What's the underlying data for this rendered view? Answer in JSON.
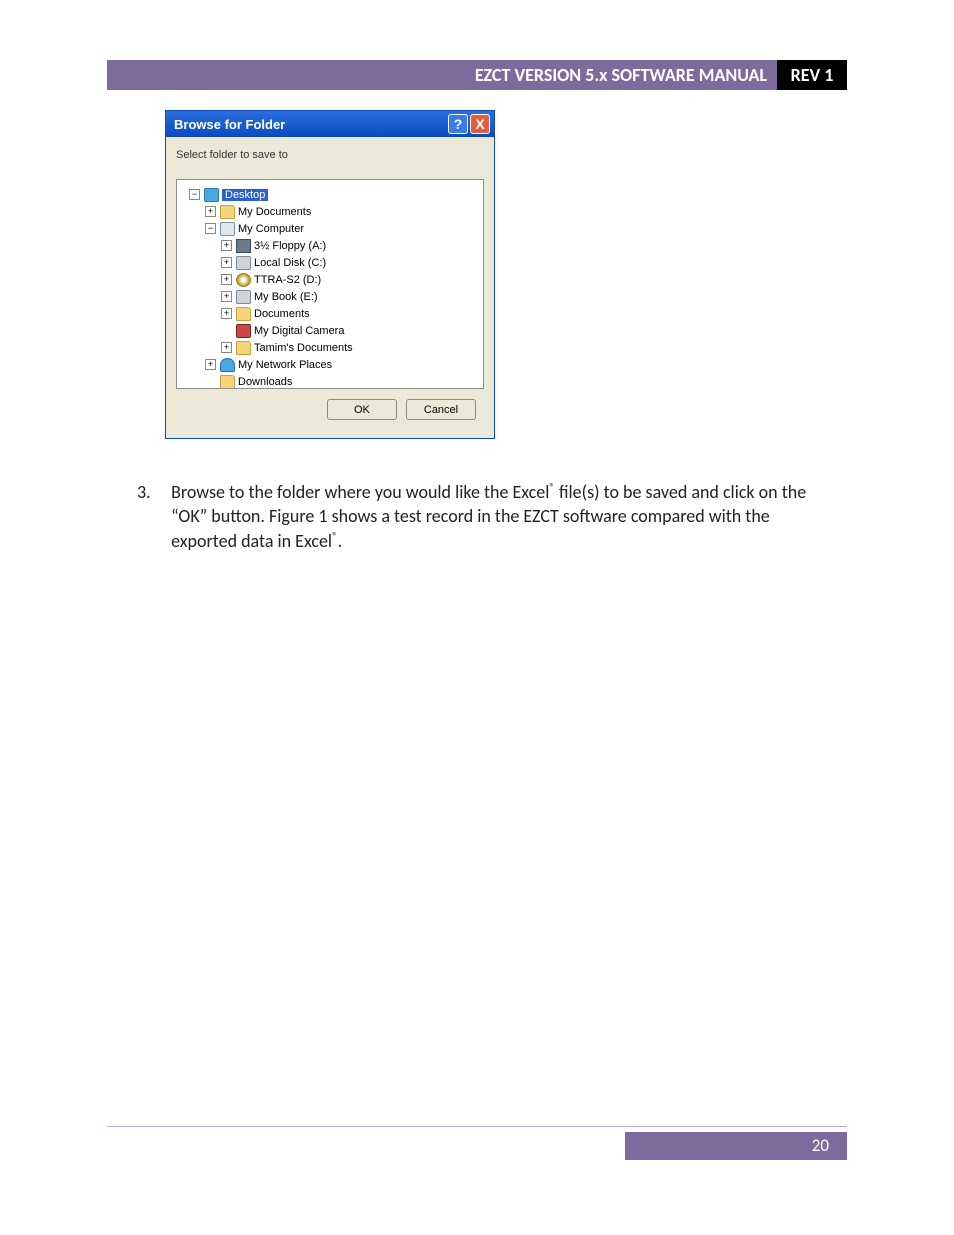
{
  "header": {
    "title": "EZCT VERSION 5.x SOFTWARE MANUAL",
    "rev": "REV 1"
  },
  "dialog": {
    "title": "Browse for Folder",
    "instruction": "Select folder to save to",
    "ok": "OK",
    "cancel": "Cancel",
    "tree": {
      "desktop": "Desktop",
      "mydocs": "My Documents",
      "mycomp": "My Computer",
      "floppy": "3½ Floppy (A:)",
      "localdisk": "Local Disk (C:)",
      "ttra": "TTRA-S2 (D:)",
      "mybook": "My Book (E:)",
      "documents": "Documents",
      "camera": "My Digital Camera",
      "tamim": "Tamim's Documents",
      "netplaces": "My Network Places",
      "downloads": "Downloads"
    }
  },
  "body": {
    "num": "3.",
    "text1": "Browse to the folder where you would like the Excel",
    "text2": " file(s) to be saved and click on the “OK” button. Figure 1 shows a test record in the EZCT software compared with the exported data in Excel",
    "text3": "."
  },
  "footer": {
    "page": "20"
  }
}
